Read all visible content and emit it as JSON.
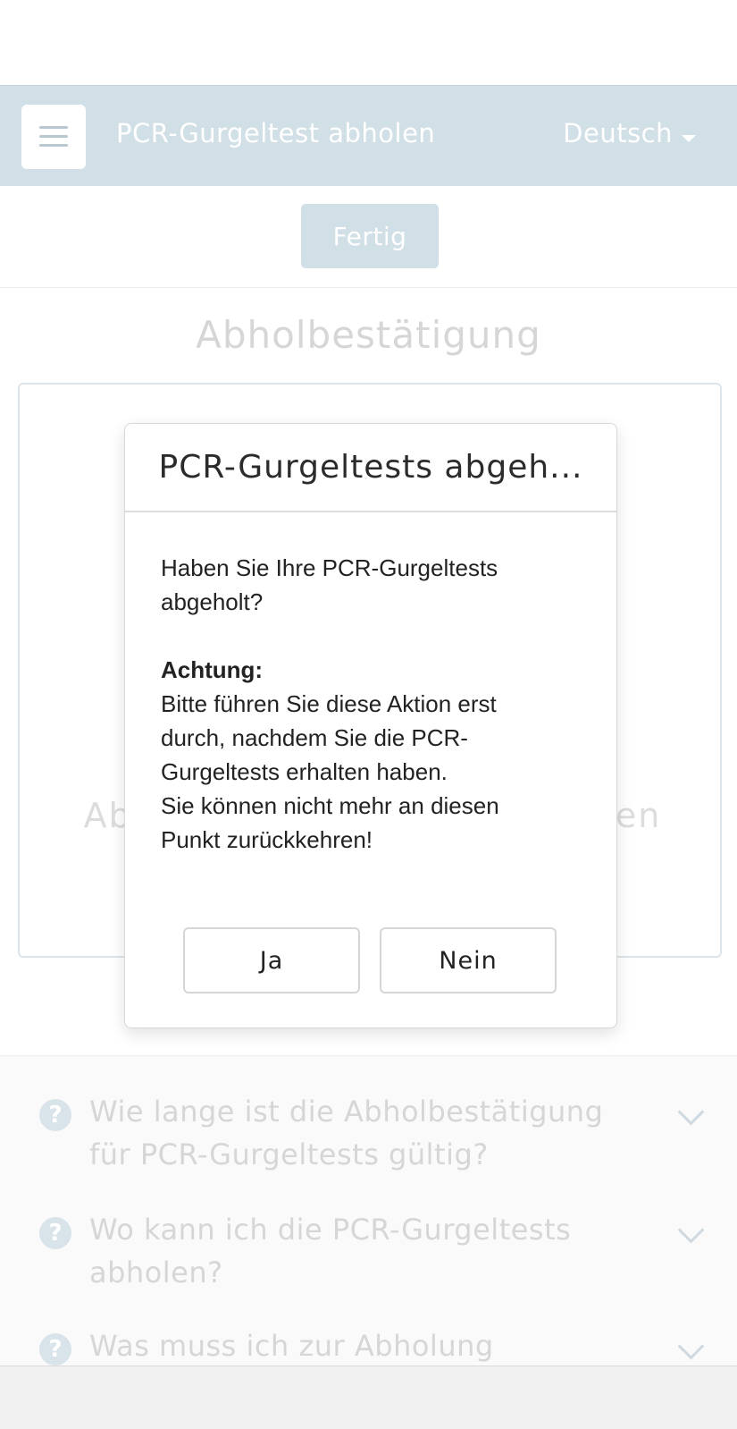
{
  "nav": {
    "title": "PCR-Gurgeltest abholen",
    "language": "Deutsch"
  },
  "toolbar": {
    "done_label": "Fertig"
  },
  "section": {
    "title": "Abholbestätigung"
  },
  "card": {
    "partial_text_left": "Abh",
    "partial_text_right": "ten"
  },
  "faq": {
    "items": [
      {
        "question": "Wie lange ist die Abholbestätigung für PCR-Gurgeltests gültig?"
      },
      {
        "question": "Wo kann ich die PCR-Gurgeltests abholen?"
      },
      {
        "question": "Was muss ich zur Abholung"
      }
    ]
  },
  "modal": {
    "title": "PCR-Gurgeltests abgeh...",
    "question_line1": "Haben Sie Ihre PCR-Gurgeltests",
    "question_line2": "abgeholt?",
    "warning_label": "Achtung:",
    "warning_line1": "Bitte führen Sie diese Aktion erst",
    "warning_line2": "durch, nachdem Sie die PCR-",
    "warning_line3": "Gurgeltests erhalten haben.",
    "warning_line4": "Sie können nicht mehr an diesen",
    "warning_line5": "Punkt zurückkehren!",
    "yes_label": "Ja",
    "no_label": "Nein"
  }
}
